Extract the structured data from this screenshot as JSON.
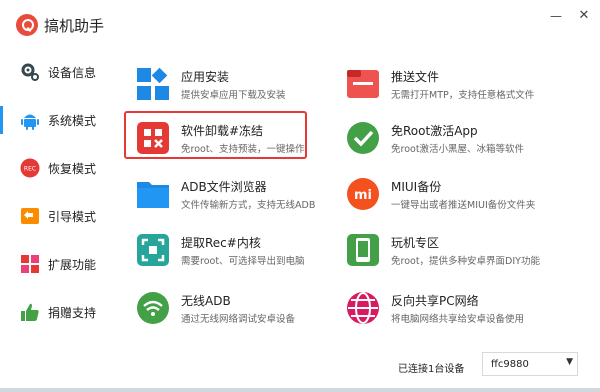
{
  "app": {
    "title": "搞机助手",
    "minimize": "—",
    "close": "✕"
  },
  "sidebar": {
    "items": [
      {
        "label": "设备信息",
        "icon": "gear-icon"
      },
      {
        "label": "系统模式",
        "icon": "android-icon",
        "active": true
      },
      {
        "label": "恢复模式",
        "icon": "rec-icon",
        "badge": "REC"
      },
      {
        "label": "引导模式",
        "icon": "boot-icon"
      },
      {
        "label": "扩展功能",
        "icon": "grid-icon"
      },
      {
        "label": "捐赠支持",
        "icon": "thumbs-up-icon"
      }
    ]
  },
  "cards": [
    {
      "title": "应用安装",
      "desc": "提供安卓应用下载及安装",
      "icon": "app-install-icon",
      "color": "#1e88e5"
    },
    {
      "title": "推送文件",
      "desc": "无需打开MTP，支持任意格式文件",
      "icon": "push-file-icon",
      "color": "#ef5350"
    },
    {
      "title": "软件卸载#冻结",
      "desc": "免root、支持预装，一键操作",
      "icon": "uninstall-icon",
      "color": "#e53935"
    },
    {
      "title": "免Root激活App",
      "desc": "免root激活小黑屋、冰箱等软件",
      "icon": "check-icon",
      "color": "#43a047"
    },
    {
      "title": "ADB文件浏览器",
      "desc": "文件传输新方式，支持无线ADB",
      "icon": "folder-icon",
      "color": "#1e88e5"
    },
    {
      "title": "MIUI备份",
      "desc": "一键导出或者推送MIUI备份文件夹",
      "icon": "mi-icon",
      "color": "#f4511e",
      "glyph": "mi"
    },
    {
      "title": "提取Rec#内核",
      "desc": "需要root、可选择导出到电脑",
      "icon": "extract-icon",
      "color": "#26a69a"
    },
    {
      "title": "玩机专区",
      "desc": "免root，提供多种安卓界面DIY功能",
      "icon": "phone-icon",
      "color": "#43a047"
    },
    {
      "title": "无线ADB",
      "desc": "通过无线网络调试安卓设备",
      "icon": "wifi-icon",
      "color": "#43a047"
    },
    {
      "title": "反向共享PC网络",
      "desc": "将电脑网络共享给安卓设备使用",
      "icon": "globe-icon",
      "color": "#d81b60"
    }
  ],
  "status": {
    "connected": "已连接1台设备",
    "device": "ffc9880",
    "arrow": "▼"
  }
}
